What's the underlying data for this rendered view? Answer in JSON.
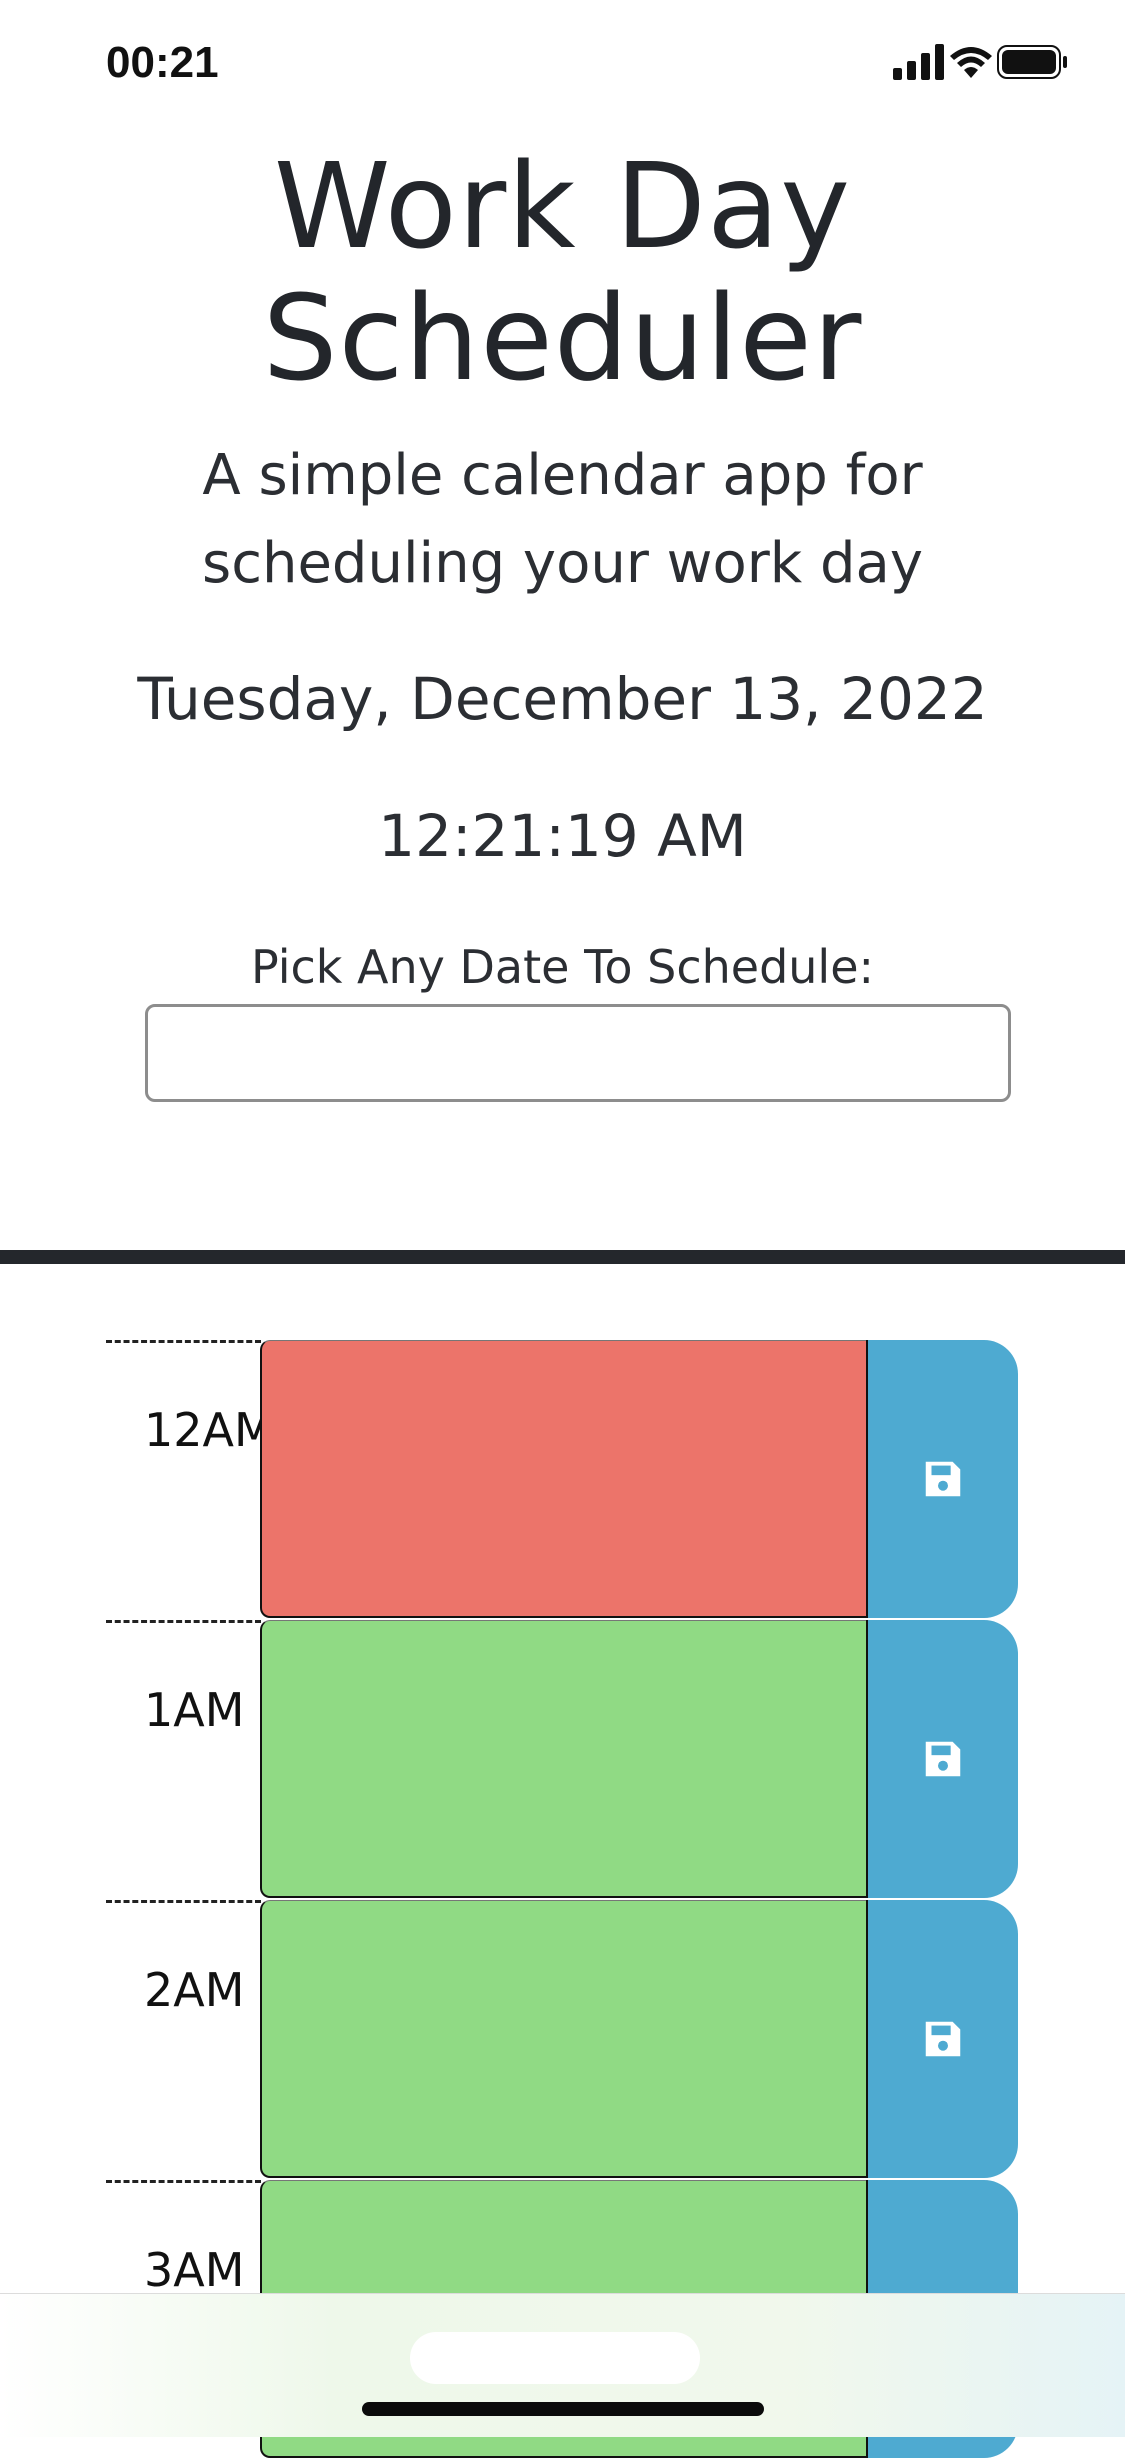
{
  "status_bar": {
    "time": "00:21",
    "icons": [
      "cellular-signal-icon",
      "wifi-icon",
      "battery-icon"
    ]
  },
  "header": {
    "title": "Work Day Scheduler",
    "lead": "A simple calendar app for scheduling your work day"
  },
  "current": {
    "date": "Tuesday, December 13, 2022",
    "time": "12:21:19 AM"
  },
  "picker": {
    "label": "Pick Any Date To Schedule:",
    "value": "",
    "placeholder": ""
  },
  "colors": {
    "present": "#ec746a",
    "future": "#90da84",
    "save_button": "#4eaad1",
    "divider": "#24272c"
  },
  "schedule": {
    "hours": [
      {
        "label": "12AM",
        "state": "present",
        "text": ""
      },
      {
        "label": "1AM",
        "state": "future",
        "text": ""
      },
      {
        "label": "2AM",
        "state": "future",
        "text": ""
      },
      {
        "label": "3AM",
        "state": "future",
        "text": ""
      }
    ],
    "save_icon": "floppy-disk-icon"
  }
}
